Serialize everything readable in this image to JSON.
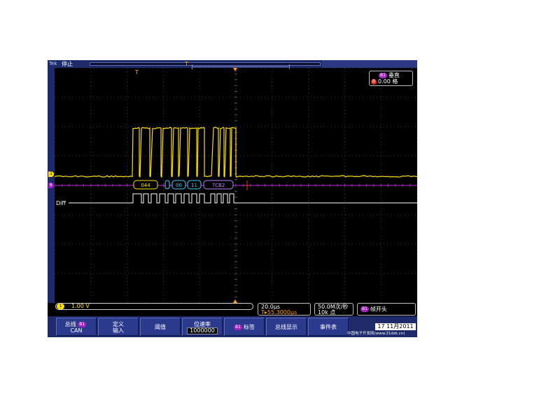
{
  "top_bar": {
    "brand": "Tek",
    "status": "停止",
    "trigger_position_marker": "T"
  },
  "vertical_info": {
    "channel_badge": "B1",
    "label": "垂直",
    "ref_badge": "B",
    "value": "0.00 格"
  },
  "markers": {
    "trigger_marker": "T",
    "ch1_marker": "1",
    "bus_marker": "B1"
  },
  "bus_decode": {
    "packets": [
      "044",
      "00",
      "11",
      "7CB2"
    ],
    "label": "Diff"
  },
  "status_row": {
    "channel": {
      "badge": "1",
      "scale": "1.00 V"
    },
    "timebase": {
      "scale": "20.0μs",
      "delay_icon": "T",
      "delay": "▸55.3000μs"
    },
    "acquisition": {
      "sample_rate": "50.0M次/秒",
      "record_length": "10k 点"
    },
    "trigger": {
      "badge": "B1",
      "label": "帧开头"
    }
  },
  "menu": [
    {
      "line1": "总线",
      "badge": "B1",
      "line2": "CAN"
    },
    {
      "line1": "定义",
      "line2": "输入"
    },
    {
      "label": "阈值"
    },
    {
      "line1": "位速率",
      "value": "1000000"
    },
    {
      "badge": "B1",
      "label": "标签"
    },
    {
      "label": "总线显示"
    },
    {
      "label": "事件表"
    }
  ],
  "date": "17 11月2011",
  "watermark": "中国电子开发网(www.21dzk.cn)",
  "colors": {
    "ch1": "#ffe000",
    "bus": "#a020c0",
    "packet_yellow": "#ffe000",
    "packet_cyan": "#40d0ff",
    "packet_purple": "#c080ff",
    "trigger": "#ffa000",
    "frame_blue": "#1e2a6a"
  }
}
